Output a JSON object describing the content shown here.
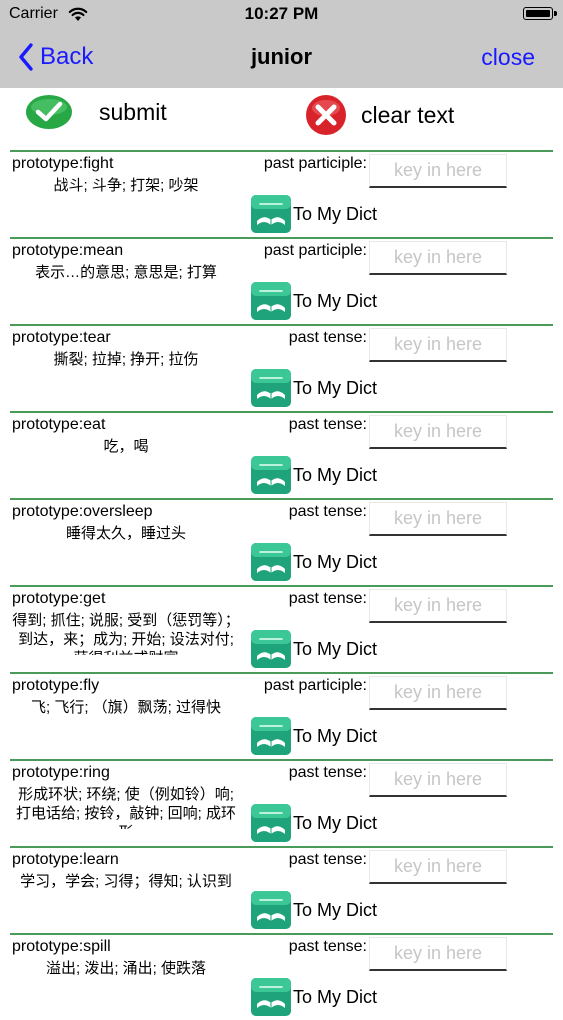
{
  "status": {
    "carrier": "Carrier",
    "time": "10:27 PM"
  },
  "nav": {
    "back_label": "Back",
    "title": "junior",
    "close_label": "close"
  },
  "actions": {
    "submit_label": "submit",
    "clear_label": "clear text"
  },
  "colors": {
    "accent": "#1a1aff",
    "divider": "#4a9a5a",
    "submit_green": "#27a845",
    "clear_red": "#d8232a",
    "dict_teal": "#1ea37a"
  },
  "icons": {
    "submit": "check-circle-icon",
    "clear": "x-circle-icon",
    "dict": "book-icon"
  },
  "entries": [
    {
      "prototype": "prototype:fight",
      "meaning": "战斗; 斗争; 打架; 吵架",
      "tense_label": "past participle:",
      "placeholder": "key in here",
      "dict_label": "To My Dict"
    },
    {
      "prototype": "prototype:mean",
      "meaning": "表示…的意思; 意思是; 打算",
      "tense_label": "past participle:",
      "placeholder": "key in here",
      "dict_label": "To My Dict"
    },
    {
      "prototype": "prototype:tear",
      "meaning": "撕裂; 拉掉; 挣开; 拉伤",
      "tense_label": "past tense:",
      "placeholder": "key in here",
      "dict_label": "To My Dict"
    },
    {
      "prototype": "prototype:eat",
      "meaning": "吃，喝",
      "tense_label": "past tense:",
      "placeholder": "key in here",
      "dict_label": "To My Dict"
    },
    {
      "prototype": "prototype:oversleep",
      "meaning": "睡得太久，睡过头",
      "tense_label": "past tense:",
      "placeholder": "key in here",
      "dict_label": "To My Dict"
    },
    {
      "prototype": "prototype:get",
      "meaning": "得到; 抓住; 说服; 受到（惩罚等）；到达，来；成为; 开始; 设法对付; 获得利益或财富",
      "tense_label": "past tense:",
      "placeholder": "key in here",
      "dict_label": "To My Dict"
    },
    {
      "prototype": "prototype:fly",
      "meaning": "飞; 飞行; （旗）飘荡; 过得快",
      "tense_label": "past participle:",
      "placeholder": "key in here",
      "dict_label": "To My Dict"
    },
    {
      "prototype": "prototype:ring",
      "meaning": "形成环状; 环绕; 使（例如铃）响; 打电话给; 按铃，敲钟; 回响; 成环形",
      "tense_label": "past tense:",
      "placeholder": "key in here",
      "dict_label": "To My Dict"
    },
    {
      "prototype": "prototype:learn",
      "meaning": "学习，学会; 习得；得知; 认识到",
      "tense_label": "past tense:",
      "placeholder": "key in here",
      "dict_label": "To My Dict"
    },
    {
      "prototype": "prototype:spill",
      "meaning": "溢出; 泼出; 涌出; 使跌落",
      "tense_label": "past tense:",
      "placeholder": "key in here",
      "dict_label": "To My Dict"
    }
  ]
}
